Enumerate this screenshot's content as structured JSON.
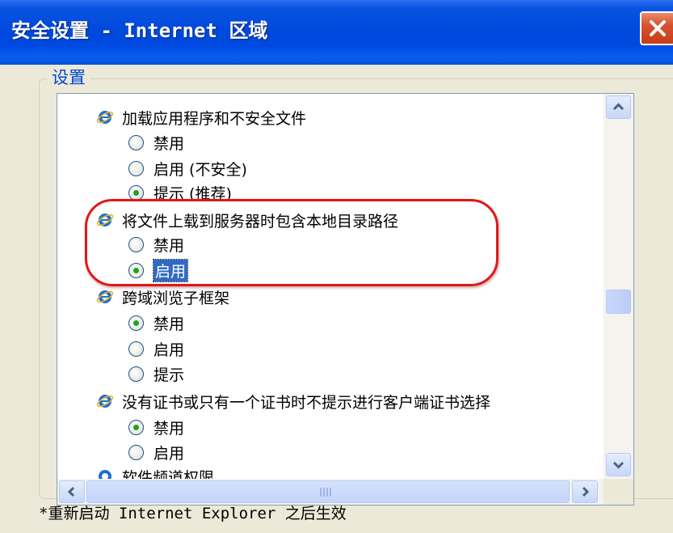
{
  "window": {
    "title": "安全设置 - Internet 区域"
  },
  "group": {
    "label": "设置"
  },
  "settings": [
    {
      "title": "加载应用程序和不安全文件",
      "options": [
        "禁用",
        "启用 (不安全)",
        "提示 (推荐)"
      ]
    },
    {
      "title": "将文件上载到服务器时包含本地目录路径",
      "options": [
        "禁用",
        "启用"
      ],
      "selected": "启用"
    },
    {
      "title": "跨域浏览子框架",
      "options": [
        "禁用",
        "启用",
        "提示"
      ],
      "selected": "禁用"
    },
    {
      "title": "没有证书或只有一个证书时不提示进行客户端证书选择",
      "options": [
        "禁用",
        "启用"
      ],
      "selected": "禁用"
    }
  ],
  "partial_setting": "软件频道权限",
  "footer": {
    "note": "*重新启动 Internet Explorer 之后生效"
  },
  "colors": {
    "title_bar": "#0049dc",
    "group_label": "#0046d5",
    "selection": "#316ac5",
    "annotation": "#e01818",
    "radio_dot": "#21a121"
  },
  "icons": {
    "setting": "internet-explorer-icon",
    "close": "close-icon"
  }
}
